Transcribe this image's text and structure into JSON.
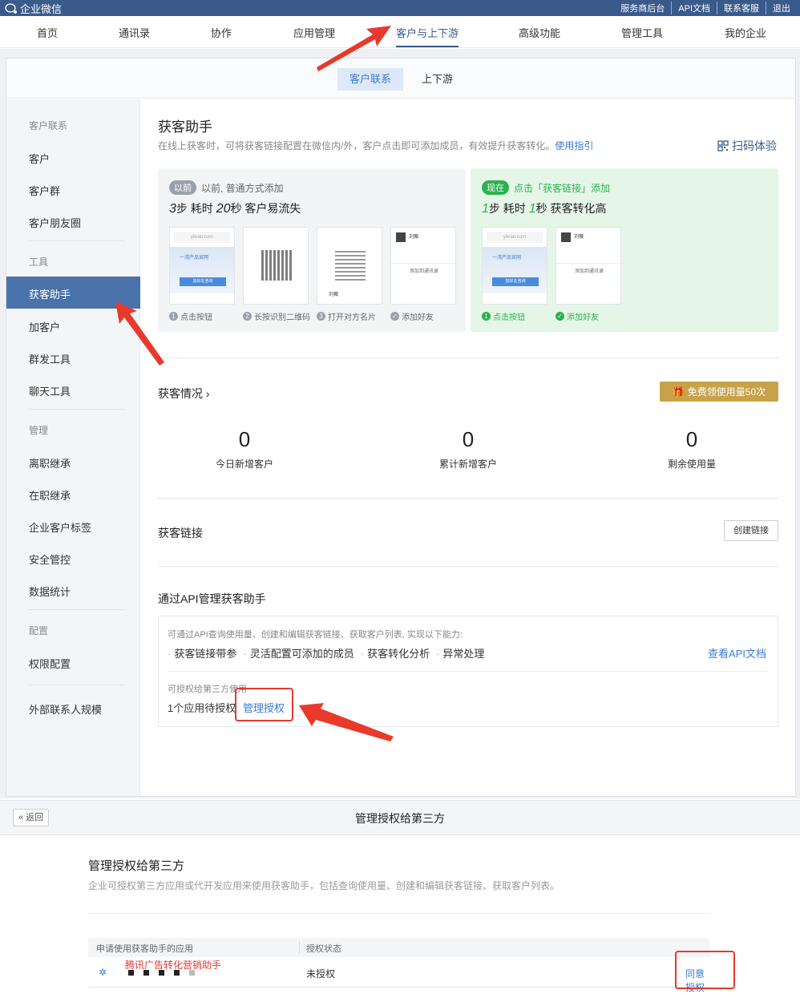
{
  "topbar": {
    "app_name": "企业微信",
    "links": [
      "服务商后台",
      "API文档",
      "联系客服",
      "退出"
    ]
  },
  "main_nav": [
    "首页",
    "通讯录",
    "协作",
    "应用管理",
    "客户与上下游",
    "高级功能",
    "管理工具",
    "我的企业"
  ],
  "sub_tabs": [
    "客户联系",
    "上下游"
  ],
  "sidebar": {
    "groups": [
      {
        "title": "客户联系",
        "items": [
          "客户",
          "客户群",
          "客户朋友圈"
        ]
      },
      {
        "title": "工具",
        "items": [
          "获客助手",
          "加客户",
          "群发工具",
          "聊天工具"
        ]
      },
      {
        "title": "管理",
        "items": [
          "离职继承",
          "在职继承",
          "企业客户标签",
          "安全管控",
          "数据统计"
        ]
      },
      {
        "title": "配置",
        "items": [
          "权限配置"
        ]
      },
      {
        "title": "",
        "items": [
          "外部联系人规模"
        ]
      }
    ]
  },
  "page": {
    "title": "获客助手",
    "desc": "在线上获客时，可将获客链接配置在微信内/外，客户点击即可添加成员，有效提升获客转化。",
    "guide": "使用指引",
    "scan": "扫码体验"
  },
  "before": {
    "badge": "以前",
    "hdr": "以前, 普通方式添加",
    "sub_a": "3",
    "sub_b": "步 耗时 ",
    "sub_c": "20",
    "sub_d": "秒 客户易流失",
    "steps": [
      "点击按钮",
      "长按识别二维码",
      "打开对方名片",
      "添加好友"
    ]
  },
  "now": {
    "badge": "现在",
    "hdr": "点击「获客链接」添加",
    "sub_a": "1",
    "sub_b": "步 耗时 ",
    "sub_c": "1",
    "sub_d": "秒 获客转化高",
    "steps": [
      "点击按钮",
      "添加好友"
    ]
  },
  "mock": {
    "url": "yiwan.com",
    "product": "一湾产品官网",
    "cta": "加好友咨询",
    "name": "刘薇",
    "company": "一湾智能",
    "add_contact": "添加到通讯录"
  },
  "stats": {
    "section": "获客情况",
    "free_btn": "免费领使用量50次",
    "items": [
      {
        "value": "0",
        "label": "今日新增客户"
      },
      {
        "value": "0",
        "label": "累计新增客户"
      },
      {
        "value": "0",
        "label": "剩余使用量"
      }
    ]
  },
  "links": {
    "section": "获客链接",
    "create": "创建链接"
  },
  "api": {
    "section": "通过API管理获客助手",
    "desc": "可通过API查询使用量、创建和编辑获客链接、获取客户列表, 实现以下能力:",
    "features": [
      "获客链接带参",
      "灵活配置可添加的成员",
      "获客转化分析",
      "异常处理"
    ],
    "doc": "查看API文档",
    "third": "可授权给第三方使用",
    "pending": "1个应用待授权",
    "manage": "管理授权"
  },
  "auth_page": {
    "back": "« 返回",
    "header": "管理授权给第三方",
    "title": "管理授权给第三方",
    "desc": "企业可授权第三方应用或代开发应用来使用获客助手，包括查询使用量、创建和编辑获客链接、获取客户列表。",
    "col_app": "申请使用获客助手的应用",
    "col_status": "授权状态",
    "app_name": "腾讯广告转化营销助手",
    "status": "未授权",
    "agree": "同意授权"
  },
  "colors": {
    "brand": "#3a5a8c",
    "link": "#3a7bd5",
    "green": "#2bb24c",
    "gold": "#c7a24a",
    "annotation_red": "#e23a2f"
  }
}
